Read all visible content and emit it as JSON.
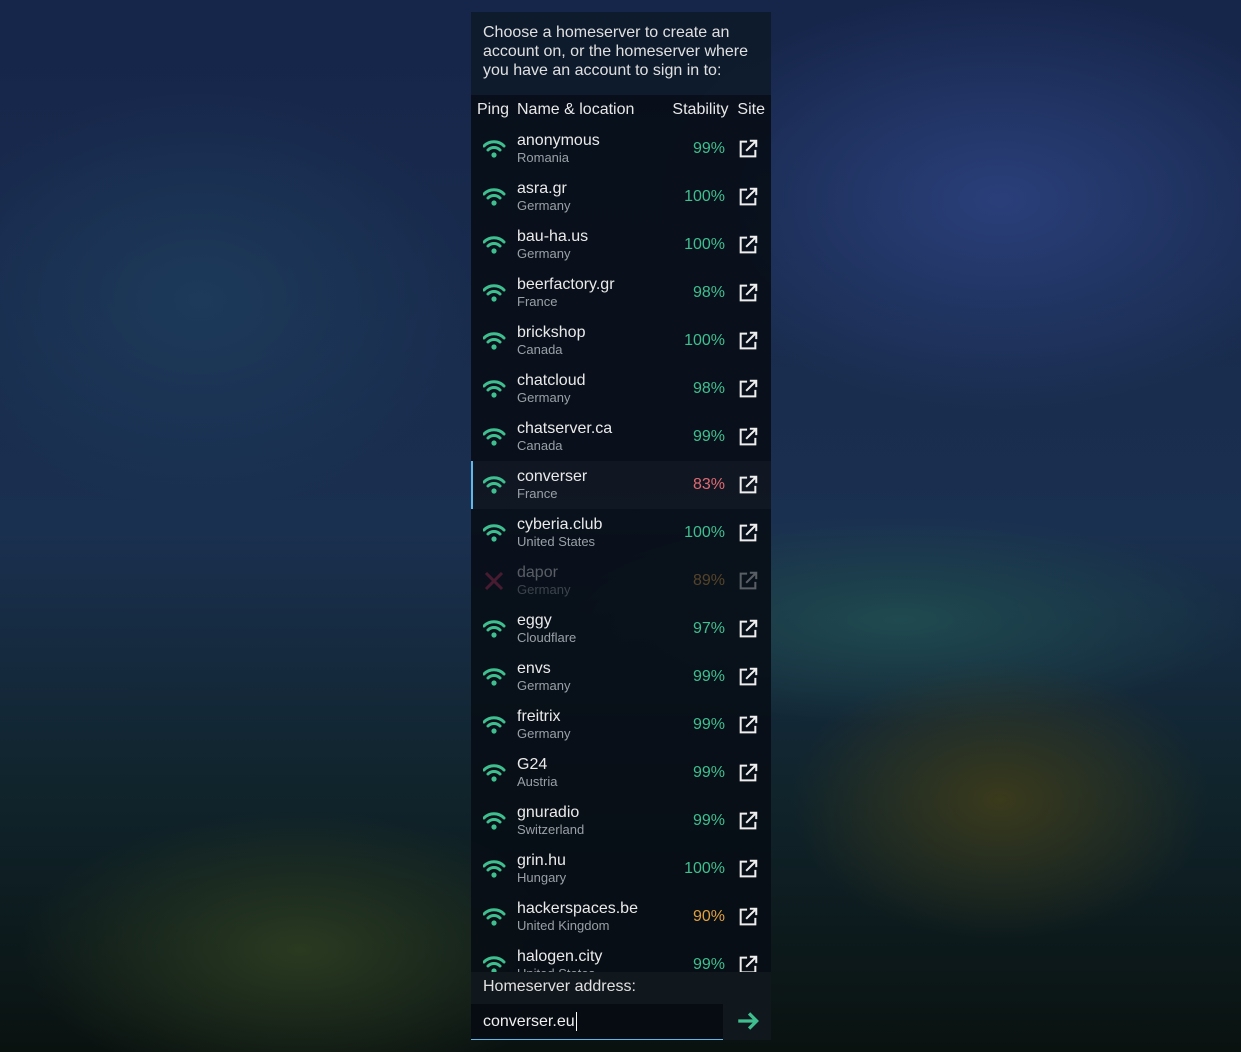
{
  "intro": "Choose a homeserver to create an account on, or the homeserver where you have an account to sign in to:",
  "columns": {
    "ping": "Ping",
    "name": "Name & location",
    "stability": "Stability",
    "site": "Site"
  },
  "colors": {
    "good": "#3fbf8f",
    "warn": "#e0a040",
    "bad": "#e06a72",
    "down": "#c0305a",
    "accent": "#5fb8e8"
  },
  "servers": [
    {
      "name": "anonymous",
      "location": "Romania",
      "stability": "99%",
      "status": "good"
    },
    {
      "name": "asra.gr",
      "location": "Germany",
      "stability": "100%",
      "status": "good"
    },
    {
      "name": "bau-ha.us",
      "location": "Germany",
      "stability": "100%",
      "status": "good"
    },
    {
      "name": "beerfactory.gr",
      "location": "France",
      "stability": "98%",
      "status": "good"
    },
    {
      "name": "brickshop",
      "location": "Canada",
      "stability": "100%",
      "status": "good"
    },
    {
      "name": "chatcloud",
      "location": "Germany",
      "stability": "98%",
      "status": "good"
    },
    {
      "name": "chatserver.ca",
      "location": "Canada",
      "stability": "99%",
      "status": "good"
    },
    {
      "name": "converser",
      "location": "France",
      "stability": "83%",
      "status": "bad",
      "selected": true
    },
    {
      "name": "cyberia.club",
      "location": "United States",
      "stability": "100%",
      "status": "good"
    },
    {
      "name": "dapor",
      "location": "Germany",
      "stability": "89%",
      "status": "warn",
      "offline": true
    },
    {
      "name": "eggy",
      "location": "Cloudflare",
      "stability": "97%",
      "status": "good"
    },
    {
      "name": "envs",
      "location": "Germany",
      "stability": "99%",
      "status": "good"
    },
    {
      "name": "freitrix",
      "location": "Germany",
      "stability": "99%",
      "status": "good"
    },
    {
      "name": "G24",
      "location": "Austria",
      "stability": "99%",
      "status": "good"
    },
    {
      "name": "gnuradio",
      "location": "Switzerland",
      "stability": "99%",
      "status": "good"
    },
    {
      "name": "grin.hu",
      "location": "Hungary",
      "stability": "100%",
      "status": "good"
    },
    {
      "name": "hackerspaces.be",
      "location": "United Kingdom",
      "stability": "90%",
      "status": "warn"
    },
    {
      "name": "halogen.city",
      "location": "United States",
      "stability": "99%",
      "status": "good"
    }
  ],
  "address": {
    "label": "Homeserver address:",
    "value": "converser.eu"
  }
}
